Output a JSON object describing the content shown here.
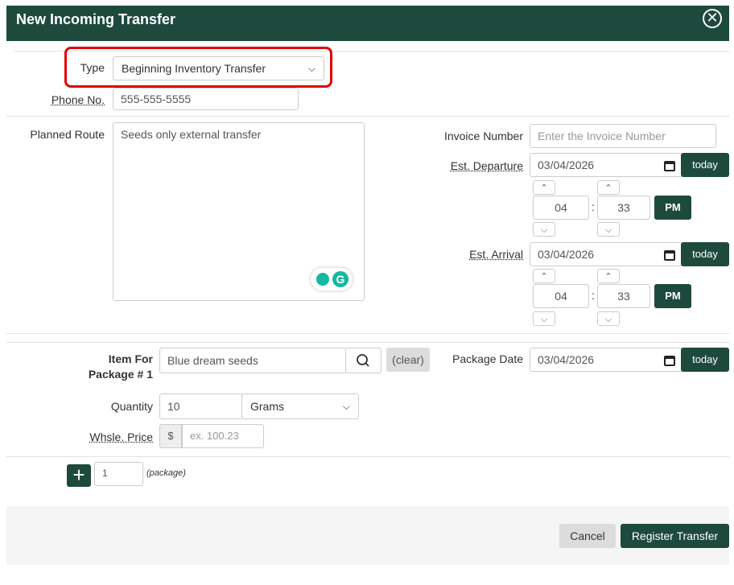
{
  "header": {
    "title": "New Incoming Transfer",
    "close_icon": "close-circle-icon"
  },
  "type": {
    "label": "Type",
    "value": "Beginning Inventory Transfer"
  },
  "phone": {
    "label": "Phone No.",
    "value": "555-555-5555"
  },
  "route": {
    "label": "Planned Route",
    "value": "Seeds only external transfer"
  },
  "invoice": {
    "label": "Invoice Number",
    "placeholder": "Enter the Invoice Number"
  },
  "departure": {
    "label": "Est. Departure",
    "date": "03/04/2026",
    "today_label": "today",
    "hour": "04",
    "minute": "33",
    "ampm": "PM",
    "sep": ":"
  },
  "arrival": {
    "label": "Est. Arrival",
    "date": "03/04/2026",
    "today_label": "today",
    "hour": "04",
    "minute": "33",
    "ampm": "PM",
    "sep": ":"
  },
  "item": {
    "label_line1": "Item For",
    "label_line2": "Package # 1",
    "value": "Blue dream seeds",
    "clear_label": "(clear)"
  },
  "package_date": {
    "label": "Package Date",
    "date": "03/04/2026",
    "today_label": "today"
  },
  "quantity": {
    "label": "Quantity",
    "value": "10",
    "unit": "Grams"
  },
  "price": {
    "label": "Whsle. Price",
    "currency": "$",
    "placeholder": "ex. 100.23"
  },
  "packages": {
    "add_icon": "plus-icon",
    "count": "1",
    "unit_label": "(package)"
  },
  "footer": {
    "cancel_label": "Cancel",
    "submit_label": "Register Transfer"
  },
  "colors": {
    "brand": "#1d4a3d",
    "highlight": "#e00000"
  }
}
